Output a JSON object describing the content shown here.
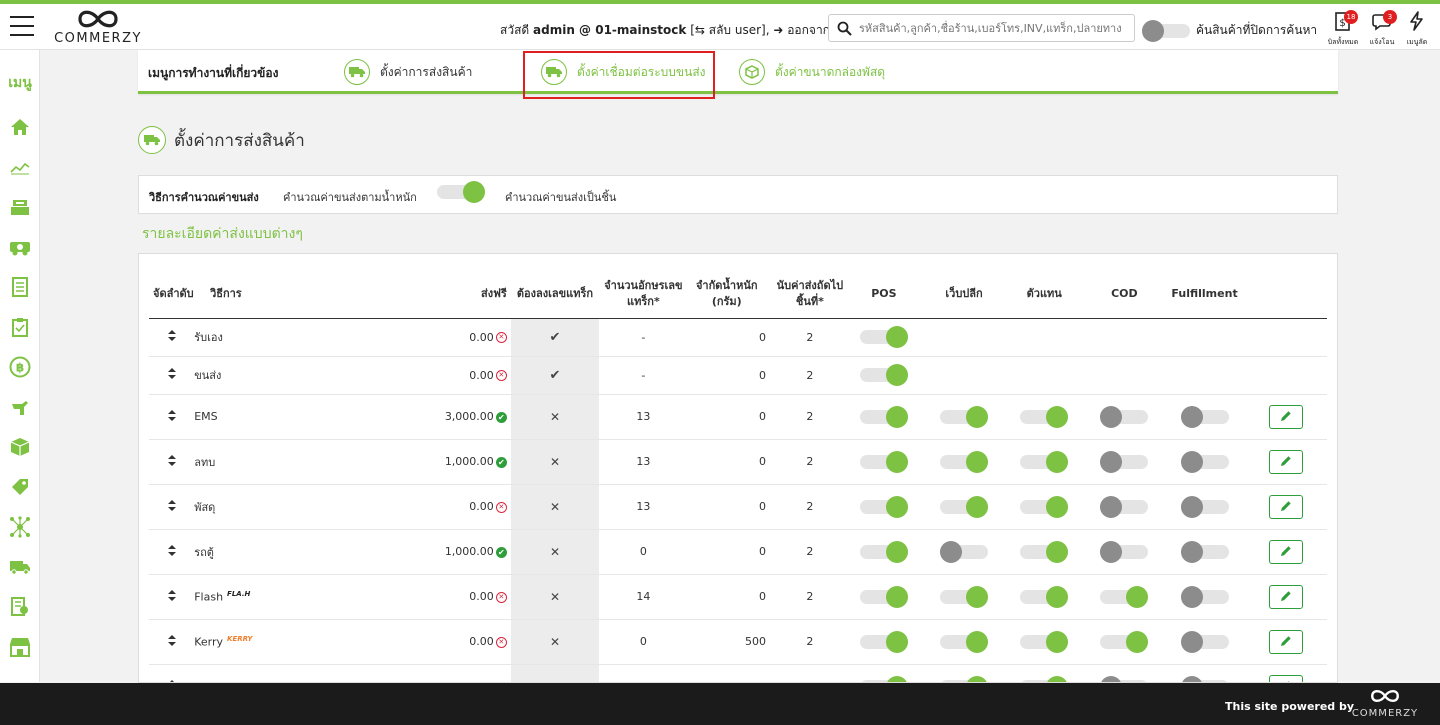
{
  "header": {
    "logo_text": "COMMERZY",
    "greeting_prefix": "สวัสดี",
    "user_store": "admin @ 01-mainstock",
    "switch_user": "[⇆ สลับ user]",
    "logout": "➜ ออกจากระบบ",
    "search_placeholder": "รหัสสินค้า,ลูกค้า,ชื่อร้าน,เบอร์โทร,INV,แทร็ก,ปลายทาง",
    "hidden_search_label": "ค้นสินค้าที่ปิดการค้นหา",
    "icons": [
      {
        "label": "บิลทั้งหมด",
        "badge": "18",
        "icon": "bill-icon"
      },
      {
        "label": "แจ้งโอน",
        "badge": "3",
        "icon": "chat-icon"
      },
      {
        "label": "เมนูลัด",
        "badge": "",
        "icon": "lightning-icon"
      }
    ]
  },
  "sidebar": {
    "menu_label": "เมนู",
    "items": [
      "home-icon",
      "chart-icon",
      "cash-register-icon",
      "truck-money-icon",
      "document-icon",
      "clipboard-icon",
      "baht-coin-icon",
      "hand-icon",
      "box-icon",
      "tag-icon",
      "network-icon",
      "delivery-truck-icon",
      "report-icon",
      "store-icon"
    ]
  },
  "related_menu": {
    "title": "เมนูการทำงานที่เกี่ยวข้อง",
    "items": [
      {
        "label": "ตั้งค่าการส่งสินค้า",
        "icon": "truck-icon"
      },
      {
        "label": "ตั้งค่าเชื่อมต่อระบบขนส่ง",
        "icon": "truck-icon"
      },
      {
        "label": "ตั้งค่าขนาดกล่องพัสดุ",
        "icon": "box-icon"
      }
    ]
  },
  "page": {
    "title": "ตั้งค่าการส่งสินค้า",
    "calc_method_label": "วิธีการคำนวณค่าขนส่ง",
    "calc_option_weight": "คำนวณค่าขนส่งตามน้ำหนัก",
    "calc_option_piece": "คำนวณค่าขนส่งเป็นชิ้น",
    "calc_by_piece": true,
    "section_title": "รายละเอียดค่าส่งแบบต่างๆ"
  },
  "table": {
    "headers": {
      "sort": "จัดลำดับ",
      "method": "วิธีการ",
      "free": "ส่งฟรี",
      "track_required": "ต้องลงเลขแทร็ก",
      "track_length": "จำนวนอักษรเลขแทร็ก*",
      "weight_limit": "จำกัดน้ำหนัก (กรัม)",
      "count_from": "นับค่าส่งถัดไปชิ้นที่*",
      "pos": "POS",
      "web": "เว็บปลีก",
      "agent": "ตัวแทน",
      "cod": "COD",
      "fulfillment": "Fulfillment"
    },
    "rows": [
      {
        "name": "รับเอง",
        "logo": "",
        "free": "0.00",
        "free_ok": false,
        "track": "✔",
        "track_len": "-",
        "weight": "0",
        "count": "2",
        "pos": true,
        "web": null,
        "agent": null,
        "cod": null,
        "ful": null,
        "edit": false
      },
      {
        "name": "ขนส่ง",
        "logo": "",
        "free": "0.00",
        "free_ok": false,
        "track": "✔",
        "track_len": "-",
        "weight": "0",
        "count": "2",
        "pos": true,
        "web": null,
        "agent": null,
        "cod": null,
        "ful": null,
        "edit": false
      },
      {
        "name": "EMS",
        "logo": "",
        "free": "3,000.00",
        "free_ok": true,
        "track": "✕",
        "track_len": "13",
        "weight": "0",
        "count": "2",
        "pos": true,
        "web": true,
        "agent": true,
        "cod": false,
        "ful": false,
        "edit": true
      },
      {
        "name": "ลทบ",
        "logo": "",
        "free": "1,000.00",
        "free_ok": true,
        "track": "✕",
        "track_len": "13",
        "weight": "0",
        "count": "2",
        "pos": true,
        "web": true,
        "agent": true,
        "cod": false,
        "ful": false,
        "edit": true
      },
      {
        "name": "พัสดุ",
        "logo": "",
        "free": "0.00",
        "free_ok": false,
        "track": "✕",
        "track_len": "13",
        "weight": "0",
        "count": "2",
        "pos": true,
        "web": true,
        "agent": true,
        "cod": false,
        "ful": false,
        "edit": true
      },
      {
        "name": "รถตู้",
        "logo": "",
        "free": "1,000.00",
        "free_ok": true,
        "track": "✕",
        "track_len": "0",
        "weight": "0",
        "count": "2",
        "pos": true,
        "web": false,
        "agent": true,
        "cod": false,
        "ful": false,
        "edit": true
      },
      {
        "name": "Flash",
        "logo": "FLA.H",
        "free": "0.00",
        "free_ok": false,
        "track": "✕",
        "track_len": "14",
        "weight": "0",
        "count": "2",
        "pos": true,
        "web": true,
        "agent": true,
        "cod": true,
        "ful": false,
        "edit": true
      },
      {
        "name": "Kerry",
        "logo": "KERRY",
        "free": "0.00",
        "free_ok": false,
        "track": "✕",
        "track_len": "0",
        "weight": "500",
        "count": "2",
        "pos": true,
        "web": true,
        "agent": true,
        "cod": true,
        "ful": false,
        "edit": true
      },
      {
        "name": "",
        "logo": "",
        "free": "",
        "free_ok": false,
        "track": "",
        "track_len": "",
        "weight": "",
        "count": "",
        "pos": true,
        "web": true,
        "agent": true,
        "cod": false,
        "ful": false,
        "edit": true
      }
    ]
  },
  "footer": {
    "powered_by": "This site powered by",
    "logo_text": "COMMERZY"
  },
  "colors": {
    "accent": "#7dc242",
    "ok": "#2e9e3a",
    "bad": "#d9263f",
    "highlight": "#e02020"
  }
}
